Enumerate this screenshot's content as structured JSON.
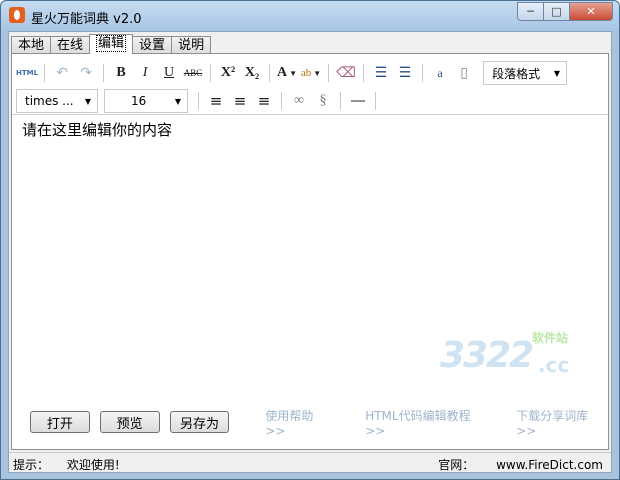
{
  "window": {
    "title": "星火万能词典 v2.0",
    "controls": {
      "minimize": "─",
      "maximize": "□",
      "close": "✕"
    }
  },
  "tabs": [
    {
      "label": "本地",
      "active": false
    },
    {
      "label": "在线",
      "active": false
    },
    {
      "label": "编辑",
      "active": true
    },
    {
      "label": "设置",
      "active": false
    },
    {
      "label": "说明",
      "active": false
    }
  ],
  "toolbar": {
    "row1": {
      "html": "HTML",
      "undo": "↶",
      "redo": "↷",
      "bold": "B",
      "italic": "I",
      "underline": "U",
      "strike": "ABC",
      "superscript": "X²",
      "subscript": "X₂",
      "font_color": "A",
      "highlight": "ab",
      "eraser": "⌫",
      "ordered_list": "☰",
      "unordered_list": "☰",
      "anchor": "a",
      "page": "▯",
      "paragraph_format": "段落格式"
    },
    "row2": {
      "font_family": "times ...",
      "font_size": "16",
      "align_left": "≡",
      "align_center": "≡",
      "align_right": "≡",
      "link": "∞",
      "unlink": "§",
      "hr": "—"
    }
  },
  "editor": {
    "content": "请在这里编辑你的内容"
  },
  "watermark": {
    "number": "3322",
    "domain": ".cc",
    "site": "软件站"
  },
  "buttons": {
    "open": "打开",
    "preview": "预览",
    "save_as": "另存为"
  },
  "links": {
    "help": "使用帮助>>",
    "html_tutorial": "HTML代码编辑教程>>",
    "download": "下载分享词库>>"
  },
  "status": {
    "hint_label": "提示：",
    "hint_text": "欢迎使用!",
    "site_label": "官网：",
    "site_url": "www.FireDict.com"
  }
}
